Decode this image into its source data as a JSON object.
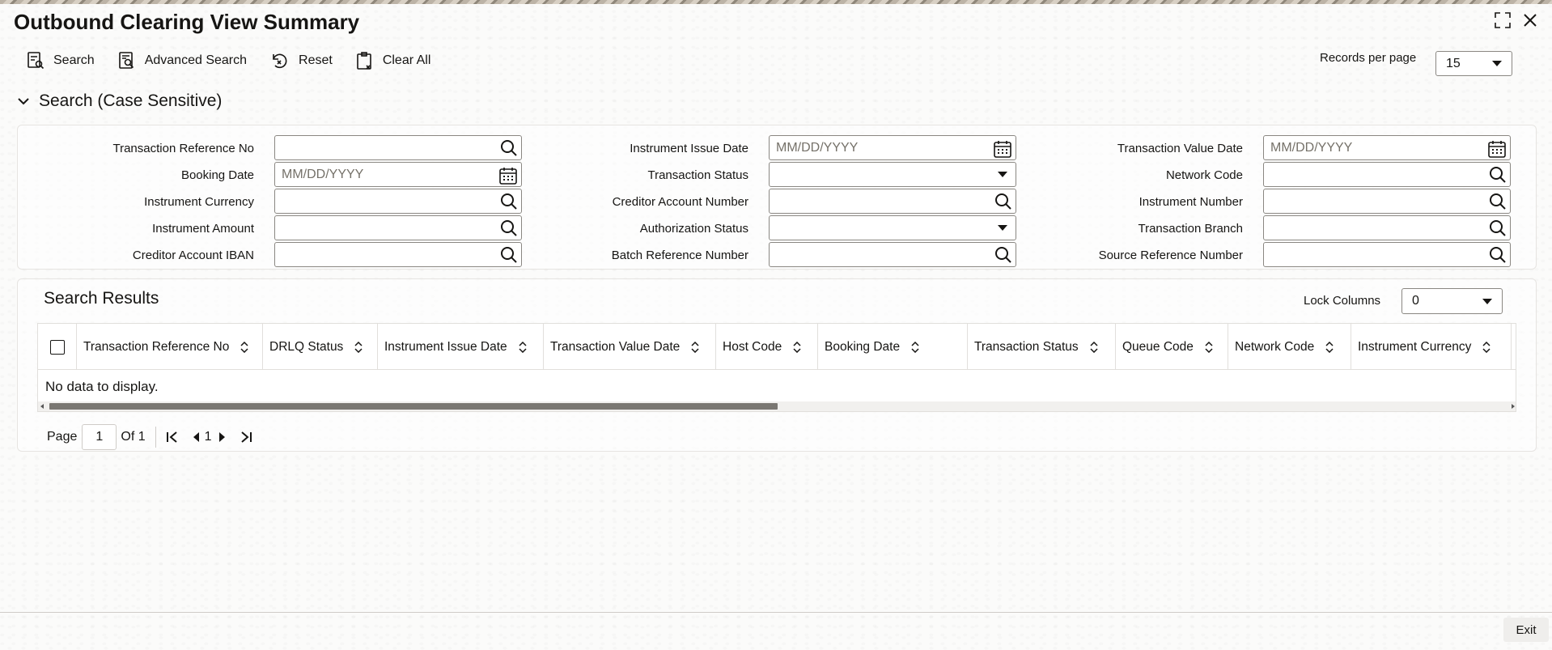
{
  "window": {
    "title": "Outbound Clearing View Summary"
  },
  "toolbar": {
    "search": "Search",
    "advanced_search": "Advanced Search",
    "reset": "Reset",
    "clear_all": "Clear All",
    "records_per_page_label": "Records per page",
    "records_per_page_value": "15"
  },
  "search_section": {
    "title": "Search (Case Sensitive)",
    "date_placeholder": "MM/DD/YYYY",
    "fields": {
      "transaction_reference_no": "Transaction Reference No",
      "instrument_issue_date": "Instrument Issue Date",
      "transaction_value_date": "Transaction Value Date",
      "booking_date": "Booking Date",
      "transaction_status": "Transaction Status",
      "network_code": "Network Code",
      "instrument_currency": "Instrument Currency",
      "creditor_account_number": "Creditor Account Number",
      "instrument_number": "Instrument Number",
      "instrument_amount": "Instrument Amount",
      "authorization_status": "Authorization Status",
      "transaction_branch": "Transaction Branch",
      "creditor_account_iban": "Creditor Account IBAN",
      "batch_reference_number": "Batch Reference Number",
      "source_reference_number": "Source Reference Number"
    }
  },
  "results": {
    "title": "Search Results",
    "lock_columns_label": "Lock Columns",
    "lock_columns_value": "0",
    "columns": [
      "Transaction Reference No",
      "DRLQ Status",
      "Instrument Issue Date",
      "Transaction Value Date",
      "Host Code",
      "Booking Date",
      "Transaction Status",
      "Queue Code",
      "Network Code",
      "Instrument Currency"
    ],
    "no_data": "No data to display.",
    "scroll_fraction": 0.5
  },
  "pagination": {
    "page_label": "Page",
    "current_page": "1",
    "of_label": "Of 1",
    "page_link": "1"
  },
  "footer": {
    "exit": "Exit"
  }
}
